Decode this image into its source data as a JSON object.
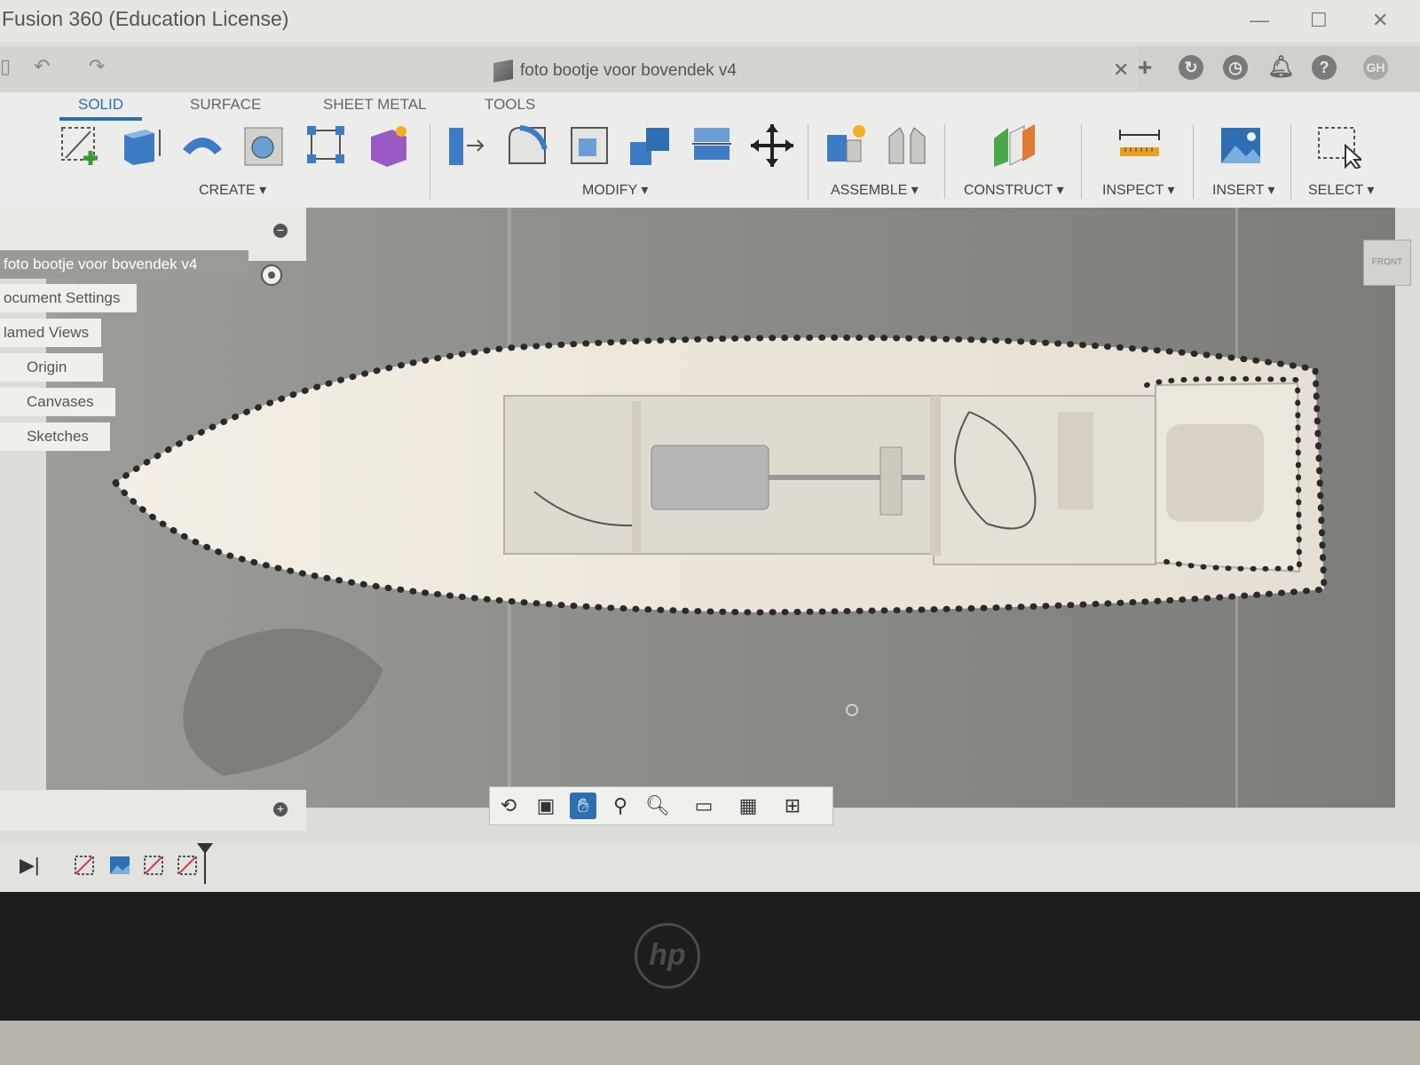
{
  "window": {
    "title": "Fusion 360 (Education License)",
    "controls": [
      "—",
      "☐",
      "✕"
    ]
  },
  "document": {
    "tab_title": "foto bootje voor bovendek v4",
    "close": "✕"
  },
  "top_icons": {
    "add": "+",
    "user": "GH"
  },
  "ribbon": {
    "tabs": [
      {
        "label": "SOLID",
        "active": true
      },
      {
        "label": "SURFACE"
      },
      {
        "label": "SHEET METAL"
      },
      {
        "label": "TOOLS"
      }
    ],
    "groups": [
      "CREATE ▾",
      "MODIFY ▾",
      "ASSEMBLE ▾",
      "CONSTRUCT ▾",
      "INSPECT ▾",
      "INSERT ▾",
      "SELECT ▾"
    ]
  },
  "browser": {
    "root": "foto bootje voor bovendek v4",
    "items": [
      "ocument Settings",
      "lamed Views",
      "Origin",
      "Canvases",
      "Sketches"
    ]
  },
  "viewcube": {
    "label": "FRONT"
  },
  "brand": {
    "logo": "hp"
  },
  "colors": {
    "accent": "#2d6fb0",
    "sketch_points": "#2a2a2a"
  }
}
